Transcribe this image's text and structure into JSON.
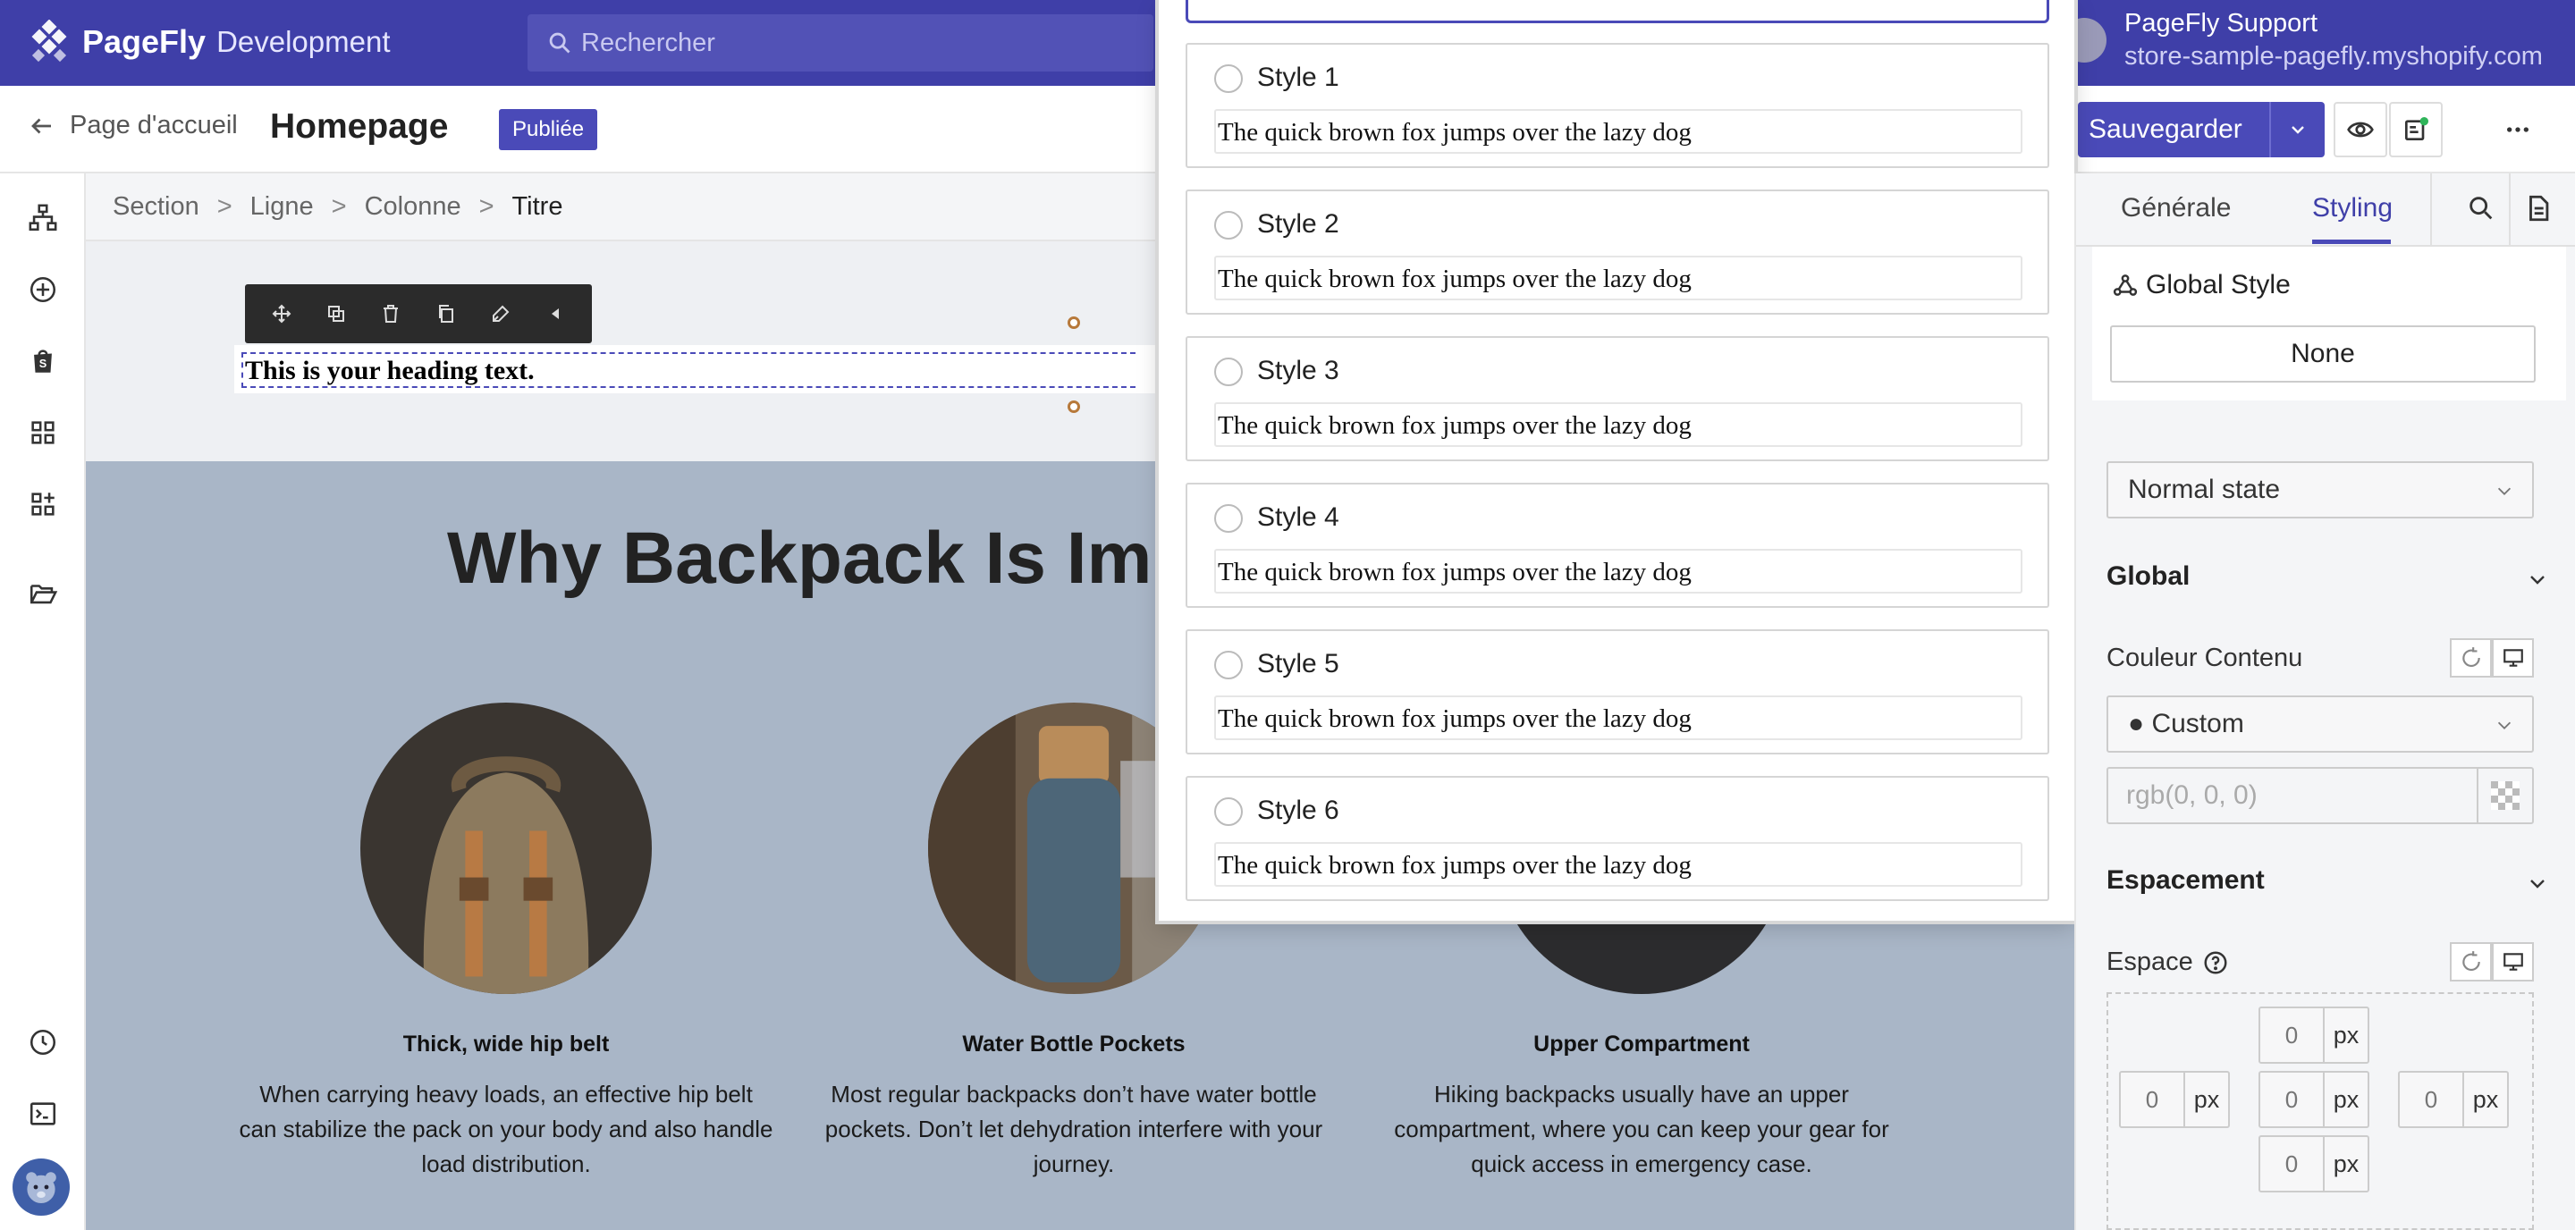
{
  "topbar": {
    "brand": "PageFly",
    "environment": "Development",
    "search_placeholder": "Rechercher",
    "account_name": "PageFly Support",
    "store_domain": "store-sample-pagefly.myshopify.com"
  },
  "header": {
    "back_label": "Page d'accueil",
    "page_title": "Homepage",
    "status": "Publiée",
    "save_label": "Sauvegarder"
  },
  "breadcrumb": [
    "Section",
    "Ligne",
    "Colonne",
    "Titre"
  ],
  "canvas": {
    "heading_text": "This is your heading text.",
    "section_title": "Why Backpack Is Impor",
    "features": [
      {
        "title": "Thick, wide hip belt",
        "description": "When carrying heavy loads, an effective hip belt can stabilize the pack on your body and also handle load distribution."
      },
      {
        "title": "Water Bottle Pockets",
        "description": "Most regular backpacks don’t have water bottle pockets. Don’t let dehydration interfere with your journey."
      },
      {
        "title": "Upper Compartment",
        "description": "Hiking backpacks usually have an upper compartment, where you can keep your gear for quick access in emergency case."
      }
    ]
  },
  "style_picker": {
    "styles": [
      {
        "name": "Style 1",
        "sample": "The quick brown fox jumps over the lazy dog"
      },
      {
        "name": "Style 2",
        "sample": "The quick brown fox jumps over the lazy dog"
      },
      {
        "name": "Style 3",
        "sample": "The quick brown fox jumps over the lazy dog"
      },
      {
        "name": "Style 4",
        "sample": "The quick brown fox jumps over the lazy dog"
      },
      {
        "name": "Style 5",
        "sample": "The quick brown fox jumps over the lazy dog"
      },
      {
        "name": "Style 6",
        "sample": "The quick brown fox jumps over the lazy dog"
      }
    ]
  },
  "panel": {
    "tabs": [
      {
        "label": "Générale",
        "active": false
      },
      {
        "label": "Styling",
        "active": true
      }
    ],
    "global_style_label": "Global Style",
    "global_style_value": "None",
    "state_select": "Normal state",
    "global_section": "Global",
    "content_color_label": "Couleur Contenu",
    "color_mode": "● Custom",
    "color_placeholder": "rgb(0, 0, 0)",
    "spacing_section": "Espacement",
    "spacing_label": "Espace",
    "spacing_unit": "px",
    "spacing_values": {
      "top": "0",
      "left": "0",
      "center": "0",
      "right": "0",
      "bottom": "0"
    }
  },
  "colors": {
    "brand": "#3f3fa8",
    "accent": "#4a4ab8",
    "section_bg": "#a9b6c7",
    "panel_bg": "#f4f5f7"
  }
}
